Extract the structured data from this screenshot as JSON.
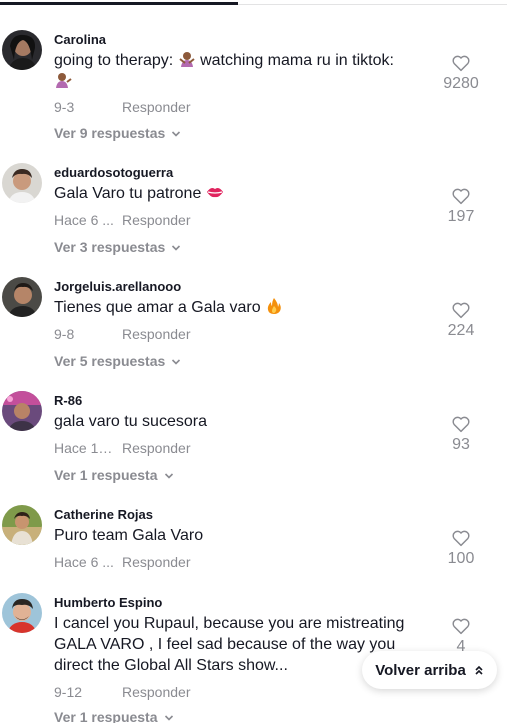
{
  "reply_label": "Responder",
  "back_to_top": "Volver arriba",
  "comments": [
    {
      "username": "Carolina",
      "text_a": "going to therapy: ",
      "text_b": " watching mama ru in tiktok:",
      "date": "9-3",
      "likes": "9280",
      "replies": "Ver 9 respuestas"
    },
    {
      "username": "eduardosotoguerra",
      "text_a": "Gala Varo tu patrone ",
      "date": "Hace 6 ...",
      "likes": "197",
      "replies": "Ver 3 respuestas"
    },
    {
      "username": "Jorgeluis.arellanooo",
      "text_a": "Tienes que amar a Gala varo ",
      "date": "9-8",
      "likes": "224",
      "replies": "Ver 5 respuestas"
    },
    {
      "username": "R-86",
      "text_a": "gala varo tu sucesora",
      "date": "Hace 1 s...",
      "likes": "93",
      "replies": "Ver 1 respuesta"
    },
    {
      "username": "Catherine Rojas",
      "text_a": "Puro team Gala Varo",
      "date": "Hace 6 ...",
      "likes": "100",
      "replies": ""
    },
    {
      "username": "Humberto Espino",
      "text_a": "I cancel you Rupaul, because you are mistreating GALA VARO , I feel sad because of the way you direct the Global All Stars show...",
      "date": "9-12",
      "likes": "4",
      "replies": "Ver 1 respuesta"
    }
  ]
}
